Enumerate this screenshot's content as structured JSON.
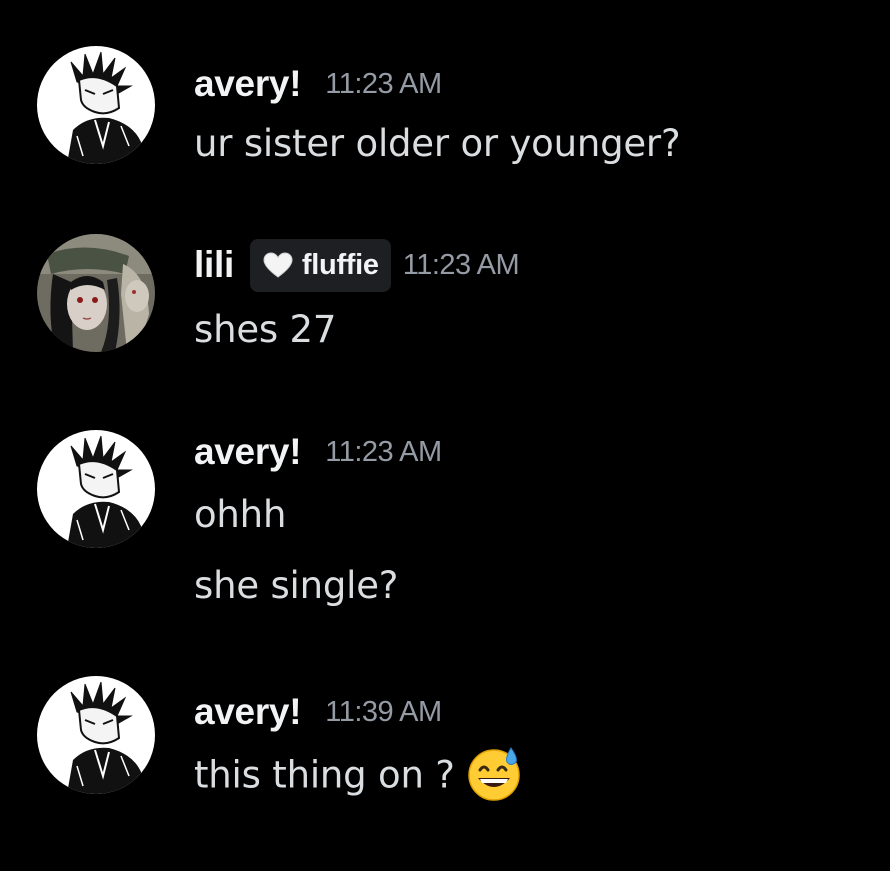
{
  "colors": {
    "background": "#000000",
    "username": "#f2f3f5",
    "timestamp": "#949ba4",
    "message_text": "#dbdee1",
    "tag_background": "#1e1f22"
  },
  "messages": [
    {
      "author": "avery!",
      "avatar_icon": "anime-character-avatar-icon",
      "timestamp": "11:23 AM",
      "lines": [
        "ur sister older or younger?"
      ]
    },
    {
      "author": "lili",
      "avatar_icon": "anime-girl-avatar-icon",
      "tag": {
        "icon": "white-heart-icon",
        "label": "fluffie"
      },
      "timestamp": "11:23 AM",
      "lines": [
        "shes 27"
      ]
    },
    {
      "author": "avery!",
      "avatar_icon": "anime-character-avatar-icon",
      "timestamp": "11:23 AM",
      "lines": [
        "ohhh",
        "she single?"
      ]
    },
    {
      "author": "avery!",
      "avatar_icon": "anime-character-avatar-icon",
      "timestamp": "11:39 AM",
      "lines": [
        "this thing on ?"
      ],
      "emoji": "grinning-face-with-sweat-emoji"
    }
  ]
}
